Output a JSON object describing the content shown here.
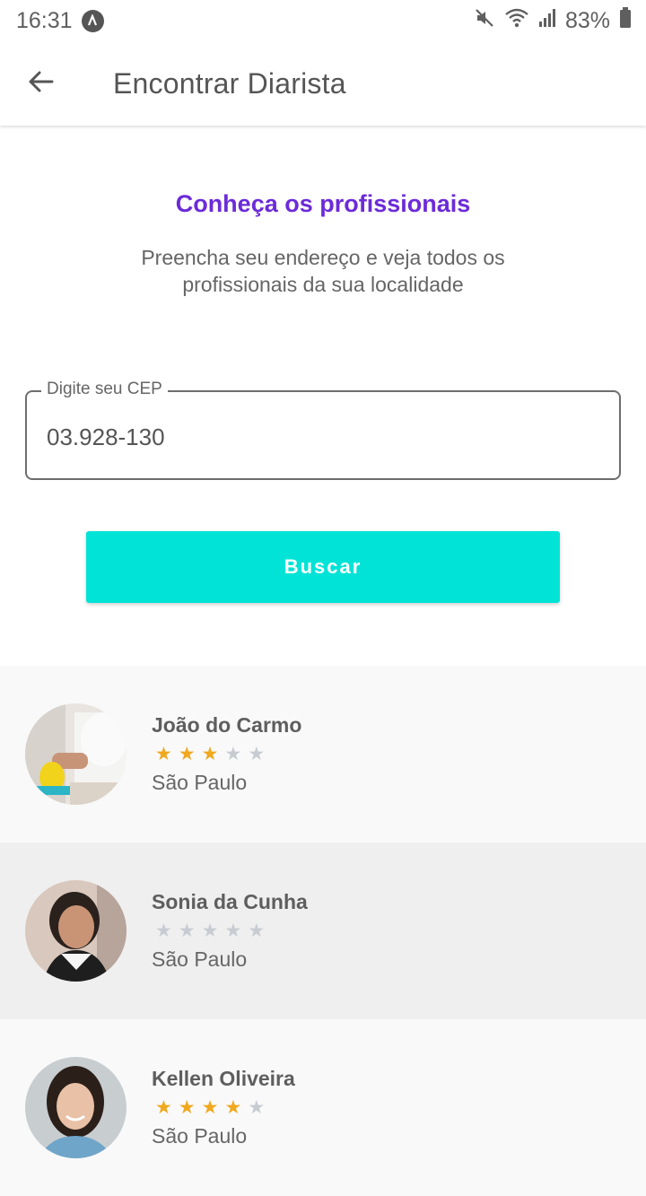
{
  "status_bar": {
    "time": "16:31",
    "battery": "83%",
    "icons": [
      "app-badge-icon",
      "mute-icon",
      "wifi-icon",
      "signal-icon",
      "battery-icon"
    ]
  },
  "app_bar": {
    "title": "Encontrar Diarista",
    "back_icon": "arrow-left-icon"
  },
  "intro": {
    "title": "Conheça os profissionais",
    "text": "Preencha seu endereço e veja todos os profissionais da sua localidade"
  },
  "cep_field": {
    "label": "Digite seu CEP",
    "value": "03.928-130"
  },
  "search_button": {
    "label": "Buscar"
  },
  "professionals": [
    {
      "name": "João do Carmo",
      "rating": 3,
      "max_rating": 5,
      "city": "São Paulo"
    },
    {
      "name": "Sonia da Cunha",
      "rating": 0,
      "max_rating": 5,
      "city": "São Paulo"
    },
    {
      "name": "Kellen Oliveira",
      "rating": 4,
      "max_rating": 5,
      "city": "São Paulo"
    }
  ],
  "colors": {
    "accent_purple": "#6c2bd9",
    "button_cyan": "#00e3d6",
    "star_filled": "#f0a81f",
    "star_empty": "#c8ccd2"
  }
}
